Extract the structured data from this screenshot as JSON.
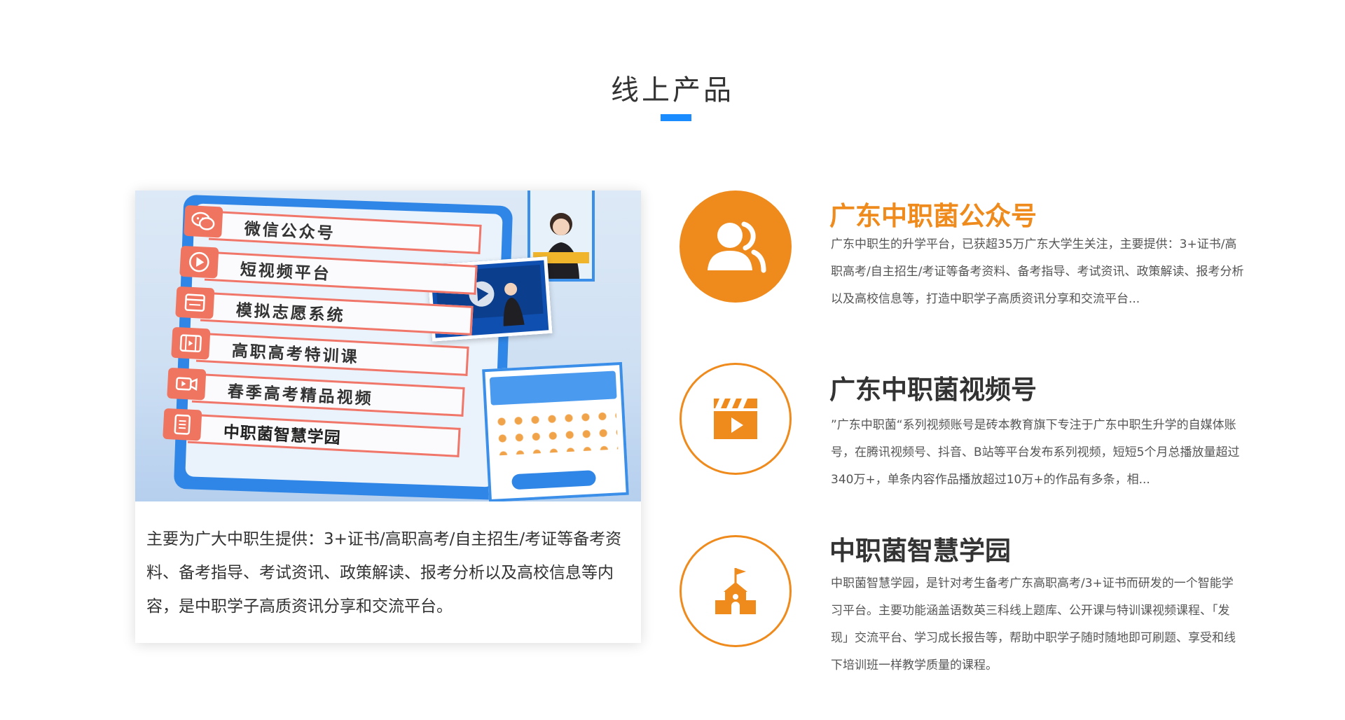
{
  "section": {
    "title": "线上产品"
  },
  "colors": {
    "accent": "#ef8a1c",
    "underline": "#1a8cff",
    "board": "#2f86e6",
    "menu_icon": "#f07560"
  },
  "card": {
    "menu_items": [
      {
        "label": "微信公众号",
        "icon": "wechat-icon"
      },
      {
        "label": "短视频平台",
        "icon": "play-icon"
      },
      {
        "label": "模拟志愿系统",
        "icon": "form-icon"
      },
      {
        "label": "高职高考特训课",
        "icon": "film-icon"
      },
      {
        "label": "春季高考精品视频",
        "icon": "video-camera-icon"
      },
      {
        "label": "中职菌智慧学园",
        "icon": "document-icon"
      }
    ],
    "description": "主要为广大中职生提供：3+证书/高职高考/自主招生/考证等备考资料、备考指导、考试资讯、政策解读、报考分析以及高校信息等内容，是中职学子高质资讯分享和交流平台。"
  },
  "products": [
    {
      "title": "广东中职菌公众号",
      "icon": "users-icon",
      "active": true,
      "description": "广东中职生的升学平台，已获超35万广东大学生关注，主要提供：3+证书/高职高考/自主招生/考证等备考资料、备考指导、考试资讯、政策解读、报考分析以及高校信息等，打造中职学子高质资讯分享和交流平台..."
    },
    {
      "title": "广东中职菌视频号",
      "icon": "clapperboard-play-icon",
      "active": false,
      "description": "”广东中职菌“系列视频账号是砖本教育旗下专注于广东中职生升学的自媒体账号，在腾讯视频号、抖音、B站等平台发布系列视频，短短5个月总播放量超过340万+，单条内容作品播放超过10万+的作品有多条，相..."
    },
    {
      "title": "中职菌智慧学园",
      "icon": "school-flag-icon",
      "active": false,
      "description": "中职菌智慧学园，是针对考生备考广东高职高考/3+证书而研发的一个智能学习平台。主要功能涵盖语数英三科线上题库、公开课与特训课视频课程、「发现」交流平台、学习成长报告等，帮助中职学子随时随地即可刷题、享受和线下培训班一样教学质量的课程。"
    }
  ]
}
